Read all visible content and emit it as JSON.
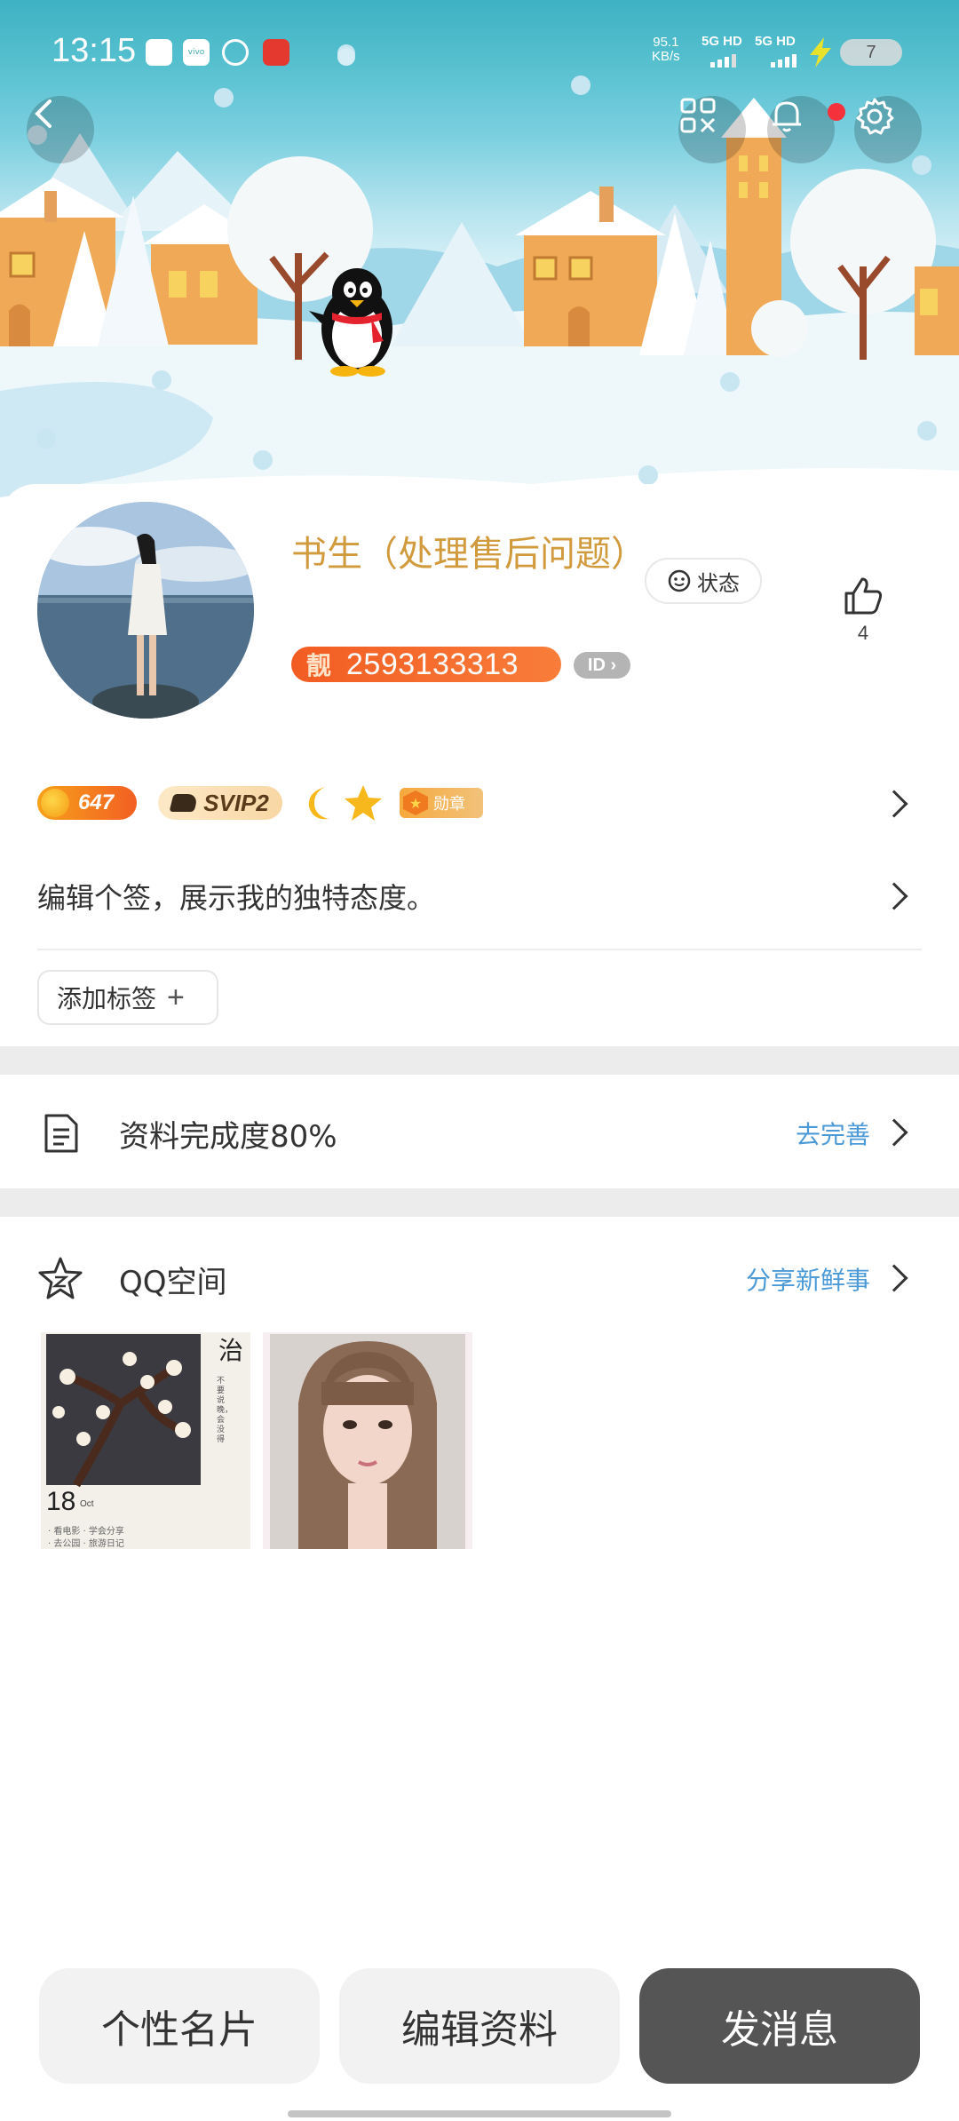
{
  "status_bar": {
    "time": "13:15",
    "net_speed_value": "95.1",
    "net_speed_unit": "KB/s",
    "sim1": "5G HD",
    "sim2": "5G HD",
    "battery": "7"
  },
  "header": {
    "back_icon": "chevron-left-icon",
    "qr_icon": "qr-code-icon",
    "bell_icon": "bell-icon",
    "settings_icon": "gear-icon",
    "has_notification_dot": true
  },
  "profile": {
    "nickname": "书生（处理售后问题）",
    "status_label": "状态",
    "pretty_badge": "靓",
    "qq_number": "2593133313",
    "id_badge": "ID",
    "likes": "4"
  },
  "badges": {
    "sun_level": "647",
    "svip": "SVIP2",
    "medal": "勋章"
  },
  "signature": "编辑个签，展示我的独特态度。",
  "add_tag_label": "添加标签",
  "completion": {
    "label": "资料完成度80%",
    "action": "去完善"
  },
  "qzone": {
    "title": "QQ空间",
    "action": "分享新鲜事",
    "thumb1_day": "18",
    "thumb1_month": "Oct",
    "thumb1_lines": [
      "· 看电影 · 学会分享",
      "· 去公园 · 旅游日记"
    ],
    "thumb1_side": "不要说晚，会没得"
  },
  "bottom_buttons": {
    "card": "个性名片",
    "edit": "编辑资料",
    "message": "发消息"
  },
  "colors": {
    "nickname": "#d19a3d",
    "qq_pill": "#f25c22",
    "link_blue": "#4b9ad7",
    "message_button": "#555555"
  }
}
